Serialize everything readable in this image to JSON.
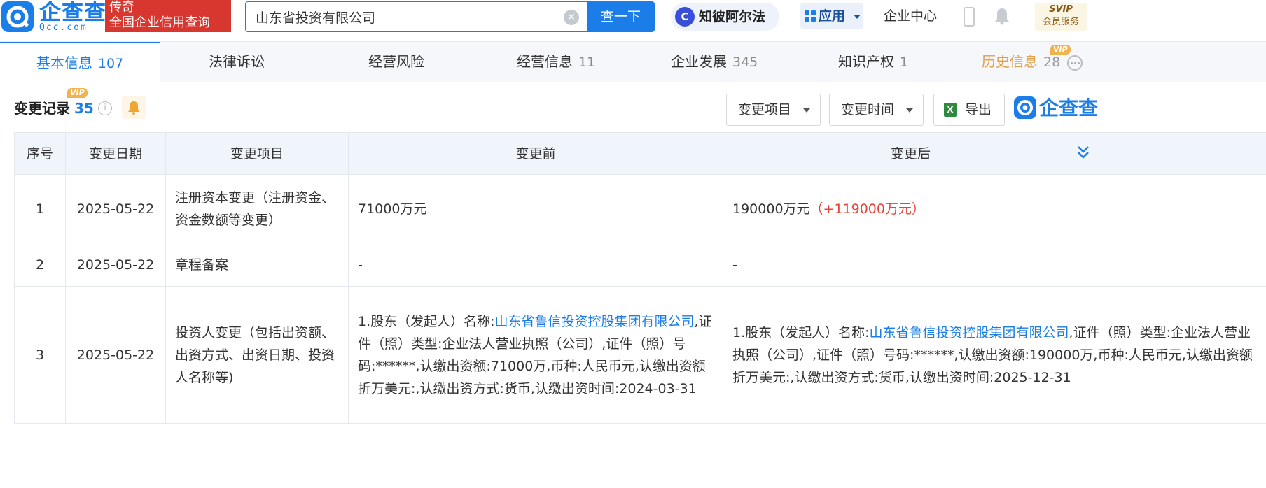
{
  "header": {
    "logo_text": "企查查",
    "logo_domain": "Qcc.com",
    "slogan_line1": "传奇",
    "slogan_line2": "全国企业信用查询",
    "search_value": "山东省投资有限公司",
    "search_button": "查一下",
    "zhibi_label": "知彼阿尔法",
    "apps_label": "应用",
    "enterprise_center": "企业中心",
    "svip_top": "SVIP",
    "svip_bottom": "会员服务"
  },
  "tabs": [
    {
      "label": "基本信息",
      "count": "107",
      "active": true
    },
    {
      "label": "法律诉讼",
      "count": ""
    },
    {
      "label": "经营风险",
      "count": ""
    },
    {
      "label": "经营信息",
      "count": "11"
    },
    {
      "label": "企业发展",
      "count": "345"
    },
    {
      "label": "知识产权",
      "count": "1"
    },
    {
      "label": "历史信息",
      "count": "28",
      "vip": "VIP"
    }
  ],
  "section": {
    "title": "变更记录",
    "count": "35",
    "vip_badge": "VIP",
    "filter_item": "变更项目",
    "filter_time": "变更时间",
    "export": "导出",
    "brand": "企查查"
  },
  "table": {
    "headers": [
      "序号",
      "变更日期",
      "变更项目",
      "变更前",
      "变更后"
    ],
    "rows": [
      {
        "no": "1",
        "date": "2025-05-22",
        "item": "注册资本变更（注册资金、资金数额等变更）",
        "before": "71000万元",
        "after": "190000万元",
        "after_delta": "（+119000万元）"
      },
      {
        "no": "2",
        "date": "2025-05-22",
        "item": "章程备案",
        "before": "-",
        "after": "-"
      },
      {
        "no": "3",
        "date": "2025-05-22",
        "item": "投资人变更（包括出资额、出资方式、出资日期、投资人名称等)",
        "before_prefix": "1.股东（发起人）名称:",
        "before_link": "山东省鲁信投资控股集团有限公司",
        "before_rest": ",证件（照）类型:企业法人营业执照（公司）,证件（照）号码:******,认缴出资额:71000万,币种:人民币元,认缴出资额折万美元:,认缴出资方式:货币,认缴出资时间:2024-03-31",
        "after_prefix": "1.股东（发起人）名称:",
        "after_link": "山东省鲁信投资控股集团有限公司",
        "after_rest": ",证件（照）类型:企业法人营业执照（公司）,证件（照）号码:******,认缴出资额:190000万,币种:人民币元,认缴出资额折万美元:,认缴出资方式:货币,认缴出资时间:2025-12-31"
      }
    ]
  },
  "colors": {
    "brand_blue": "#1b7ee8",
    "slogan_red": "#d7372f",
    "increase_red": "#e0443a",
    "vip_gold": "#f0b34e"
  }
}
